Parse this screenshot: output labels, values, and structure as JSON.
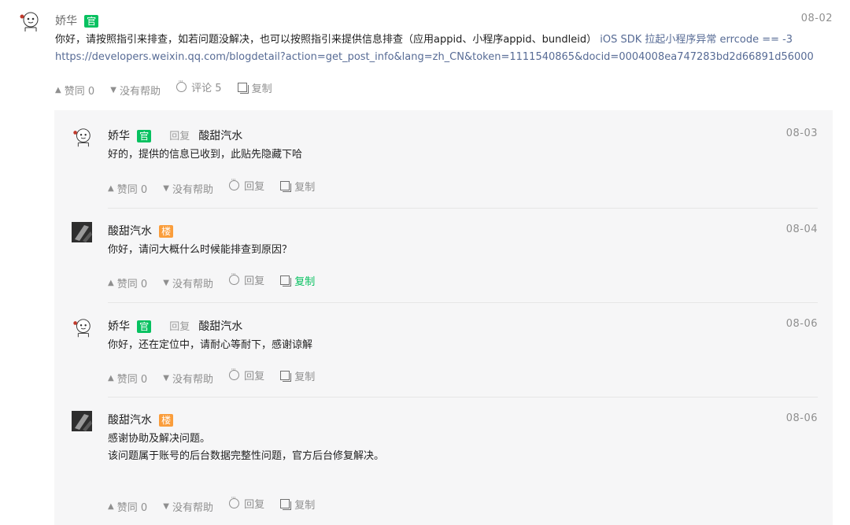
{
  "colors": {
    "official_badge": "#07c160",
    "floor_badge": "#fa9d3b",
    "link": "#576b95",
    "panel_bg": "#f6f6f7"
  },
  "main_post": {
    "author": "娇华",
    "badge": "官",
    "date": "08-02",
    "line1": "你好，请按照指引来排查，如若问题没解决，也可以按照指引来提供信息排查（应用appid、小程序appid、bundleid）",
    "line1_link": "iOS SDK 拉起小程序异常 errcode == -3",
    "line2_link": "https://developers.weixin.qq.com/blogdetail?action=get_post_info&lang=zh_CN&token=1111540865&docid=0004008ea747283bd2d66891d56000",
    "actions": {
      "agree": "赞同 0",
      "unhelpful": "没有帮助",
      "comment": "评论 5",
      "copy": "复制"
    }
  },
  "replies": [
    {
      "author": "娇华",
      "badge": "官",
      "reply_word": "回复",
      "reply_target": "酸甜汽水",
      "date": "08-03",
      "lines": [
        "好的，提供的信息已收到，此贴先隐藏下哈"
      ],
      "actions": {
        "agree": "赞同 0",
        "unhelpful": "没有帮助",
        "reply": "回复",
        "copy": "复制"
      }
    },
    {
      "author": "酸甜汽水",
      "badge": "楼",
      "date": "08-04",
      "lines": [
        "你好，请问大概什么时候能排查到原因？"
      ],
      "actions": {
        "agree": "赞同 0",
        "unhelpful": "没有帮助",
        "reply": "回复",
        "copy": "复制"
      }
    },
    {
      "author": "娇华",
      "badge": "官",
      "reply_word": "回复",
      "reply_target": "酸甜汽水",
      "date": "08-06",
      "lines": [
        "你好，还在定位中，请耐心等耐下，感谢谅解"
      ],
      "actions": {
        "agree": "赞同 0",
        "unhelpful": "没有帮助",
        "reply": "回复",
        "copy": "复制"
      }
    },
    {
      "author": "酸甜汽水",
      "badge": "楼",
      "date": "08-06",
      "lines": [
        "感谢协助及解决问题。",
        "该问题属于账号的后台数据完整性问题，官方后台修复解决。"
      ],
      "actions": {
        "agree": "赞同 0",
        "unhelpful": "没有帮助",
        "reply": "回复",
        "copy": "复制"
      }
    }
  ],
  "icons": [
    "cat-avatar-icon",
    "up-triangle-icon",
    "down-triangle-icon",
    "comment-icon",
    "copy-icon"
  ]
}
